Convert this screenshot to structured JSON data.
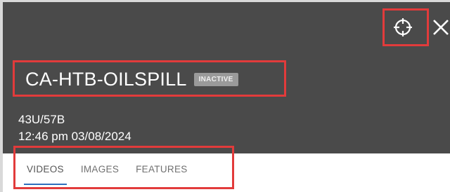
{
  "header": {
    "title": "CA-HTB-OILSPILL",
    "status_badge": "INACTIVE",
    "identifier": "43U/57B",
    "timestamp": "12:46 pm 03/08/2024",
    "locate_icon": "crosshair-icon",
    "close_icon": "close-icon"
  },
  "tabs": [
    {
      "label": "VIDEOS",
      "active": true
    },
    {
      "label": "IMAGES",
      "active": false
    },
    {
      "label": "FEATURES",
      "active": false
    }
  ],
  "colors": {
    "header_bg": "#4a4a4a",
    "badge_bg": "#9a9a9a",
    "active_tab_indicator": "#2f6fbd",
    "highlight": "#e23b3b"
  }
}
